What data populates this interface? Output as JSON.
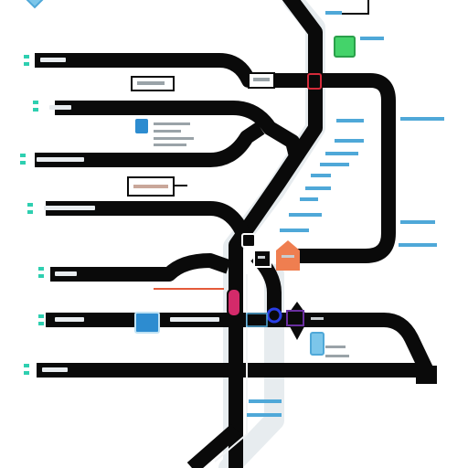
{
  "diagram": {
    "background": "#ffffff",
    "line_color": "#0a0a0a",
    "halo_color": "#dfe6ea",
    "marker_colors": {
      "teal": "#2ecfb0",
      "sky": "#4fa8d8",
      "sky_light": "#7cc6ea",
      "green": "#44d36a",
      "orange": "#ef7e50",
      "magenta": "#d42a6a",
      "blue": "#2a3fe6",
      "purple": "#6a2fa0",
      "red_accent": "#e45a3a"
    },
    "legend_text": "",
    "note": ""
  }
}
